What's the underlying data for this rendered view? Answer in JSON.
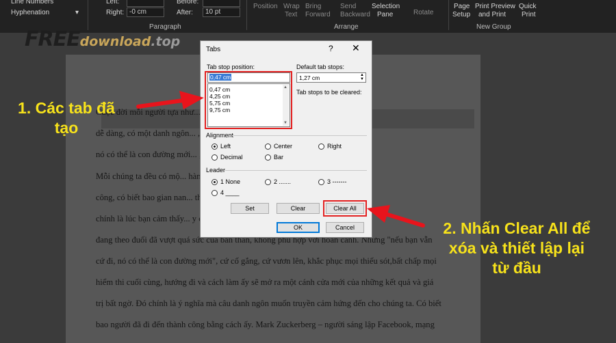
{
  "ribbon": {
    "line_numbers": "Line Numbers",
    "hyphenation": "Hyphenation",
    "left_label": "Left:",
    "right_label": "Right:",
    "right_value": "-0 cm",
    "before_label": "Before:",
    "after_label": "After:",
    "after_value": "10 pt",
    "paragraph_group": "Paragraph",
    "position": "Position",
    "wrap_text": [
      "Wrap",
      "Text"
    ],
    "bring_forward": [
      "Bring",
      "Forward"
    ],
    "send_backward": [
      "Send",
      "Backward"
    ],
    "selection_pane": [
      "Selection",
      "Pane"
    ],
    "rotate": "Rotate",
    "arrange_group": "Arrange",
    "page_setup": [
      "Page",
      "Setup"
    ],
    "print_preview": [
      "Print Preview",
      "and Print"
    ],
    "quick_print": [
      "Quick",
      "Print"
    ],
    "new_group": "New Group"
  },
  "watermark": {
    "free": "FREE",
    "download": "download",
    "top": ".top"
  },
  "document": {
    "lines": [
      "Cuộc đời mỗi người tựa như...                                                thành trình ấy cũng suôn sẻ,",
      "dễ dàng, có một danh ngôn...                                                  , nhưng nếu bạn vẫn cứ đi,",
      "nó có thể là con đường mới...                                                 , kiên trì trong cuộc sống.",
      "Mỗi chúng ta đều có mộ...                                                     hành trình chinh phục thành",
      "công, có biết bao gian nan...                                                 thất bại và tuyệt vọng, đó",
      "chính là lúc bạn cảm thấy...                                                  y cách làm mà bạn",
      "đang theo đuổi đã vượt quá sức của bản thân, không phù hợp với hoàn cảnh. Nhưng \"nếu bạn vẫn",
      "cứ đi, nó có thể là con đường mới\", cứ cố gắng, cứ vươn lên, khắc phục mọi thiếu sót,bất chấp mọi",
      "hiểm thi cuối cùng, hướng đi và cách làm ấy sẽ mở ra một cánh cửa mới của những kết quả và giá",
      "trị bất ngờ. Đó chính là ý nghĩa mà câu danh ngôn muốn truyền cảm hứng đến cho chúng ta. Có biết",
      "bao người đã đi đến thành công bằng cách ấy. Mark Zuckerberg – người sáng lập Facebook, mạng"
    ]
  },
  "dialog": {
    "title": "Tabs",
    "help": "?",
    "close": "✕",
    "tab_stop_label": "Tab stop position:",
    "tab_stop_value": "0,47 cm",
    "tab_stops": [
      "0,47 cm",
      "4,25 cm",
      "5,75 cm",
      "9,75 cm"
    ],
    "default_label": "Default tab stops:",
    "default_value": "1,27 cm",
    "cleared_label": "Tab stops to be cleared:",
    "alignment_label": "Alignment",
    "alignment": [
      "Left",
      "Center",
      "Right",
      "Decimal",
      "Bar"
    ],
    "leader_label": "Leader",
    "leader": [
      "1 None",
      "2 .......",
      "3 -------",
      "4 ____"
    ],
    "set": "Set",
    "clear": "Clear",
    "clear_all": "Clear All",
    "ok": "OK",
    "cancel": "Cancel"
  },
  "annotations": {
    "callout1": [
      "1. Các tab đã",
      "tạo"
    ],
    "callout2": [
      "2. Nhấn Clear All để",
      "xóa và thiết lập lại",
      "từ đầu"
    ],
    "arrow_color": "#e8141c",
    "text_color": "#f7e21b"
  }
}
